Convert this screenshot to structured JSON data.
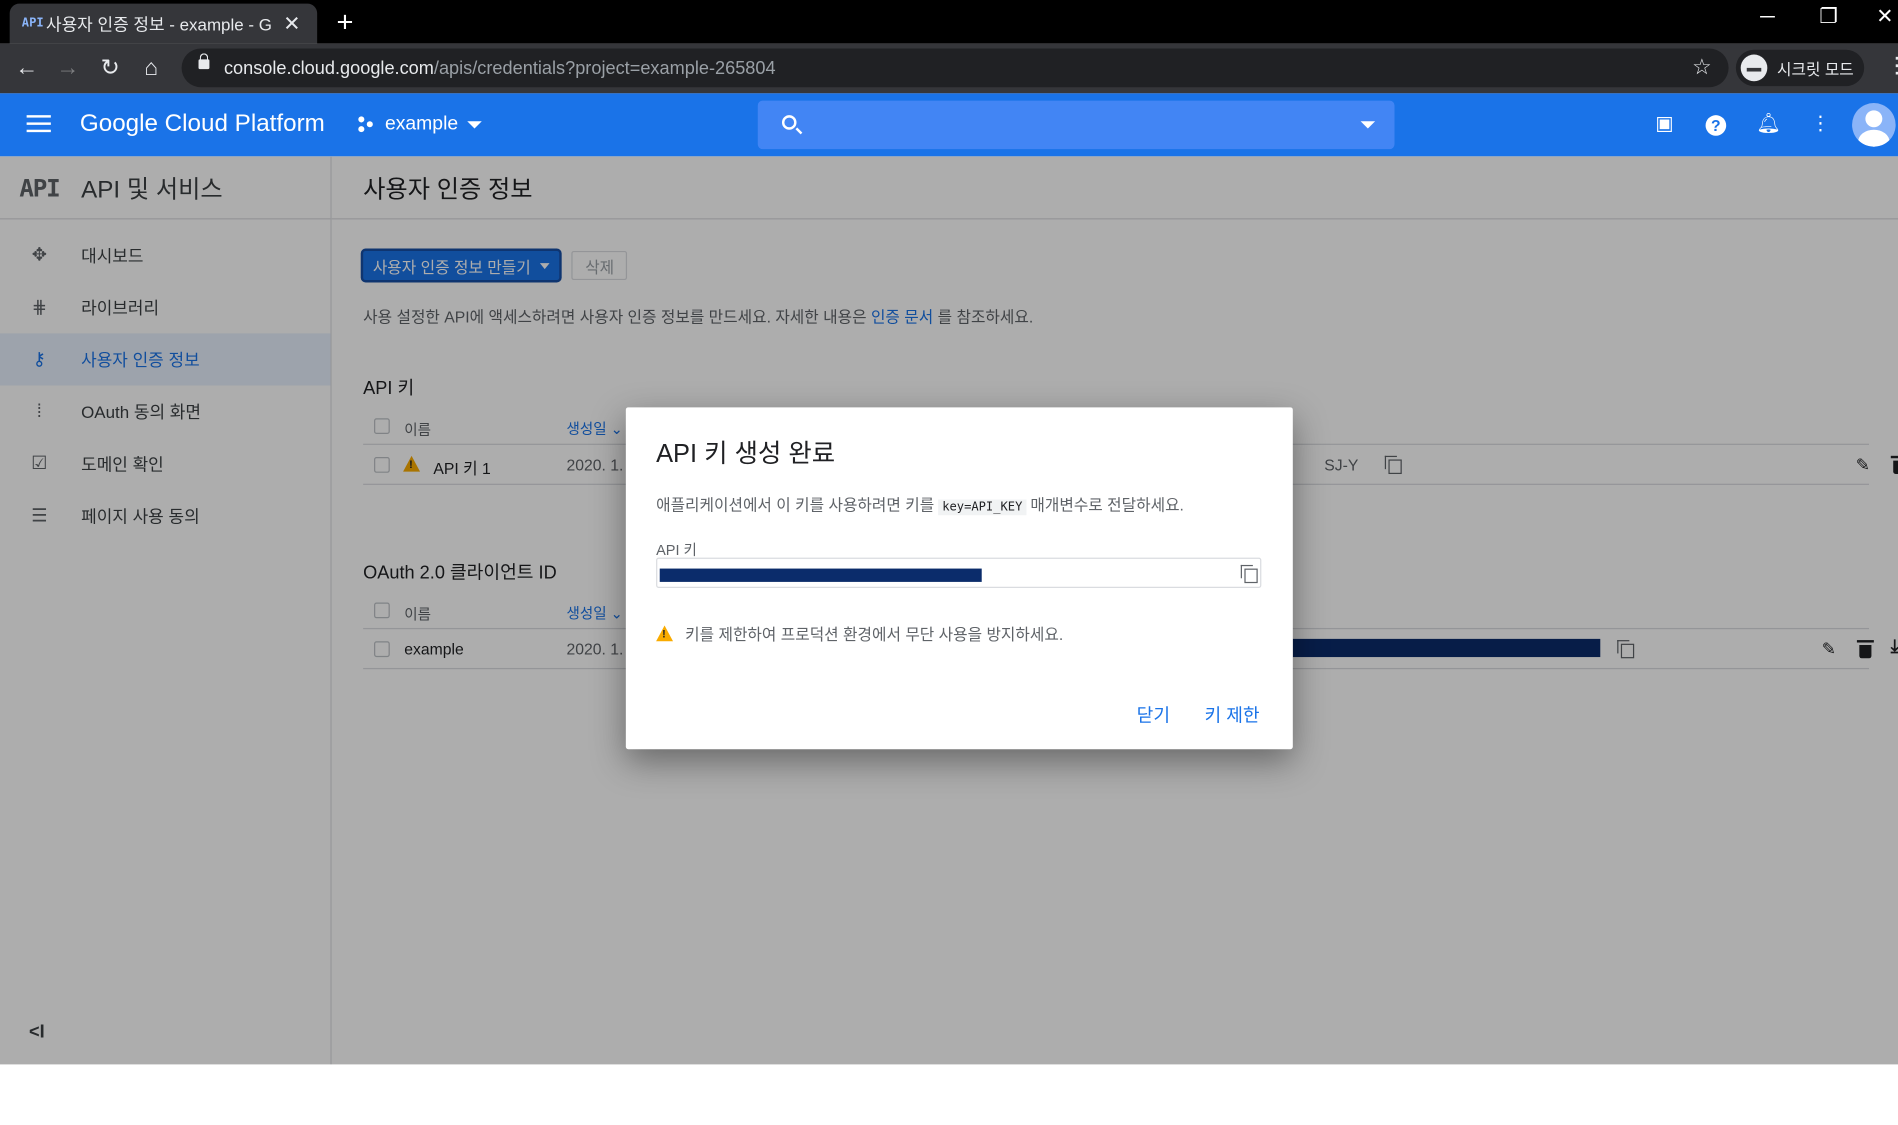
{
  "browser": {
    "tab_icon_text": "API",
    "tab_title": "사용자 인증 정보 - example - G",
    "url_host": "console.cloud.google.com",
    "url_path": "/apis/credentials?project=example-265804",
    "incognito_label": "시크릿 모드"
  },
  "header": {
    "logo_text": "Google Cloud Platform",
    "project_name": "example"
  },
  "sidebar": {
    "logo_text": "API",
    "title": "API 및 서비스",
    "items": [
      {
        "label": "대시보드",
        "icon": "dashboard-icon"
      },
      {
        "label": "라이브러리",
        "icon": "library-icon"
      },
      {
        "label": "사용자 인증 정보",
        "icon": "key-icon"
      },
      {
        "label": "OAuth 동의 화면",
        "icon": "oauth-icon"
      },
      {
        "label": "도메인 확인",
        "icon": "domain-verify-icon"
      },
      {
        "label": "페이지 사용 동의",
        "icon": "page-consent-icon"
      }
    ],
    "collapse_glyph": "<I"
  },
  "main": {
    "title": "사용자 인증 정보",
    "create_button": "사용자 인증 정보 만들기",
    "delete_button": "삭제",
    "intro_before": "사용 설정한 API에 액세스하려면 사용자 인증 정보를 만드세요. 자세한 내용은",
    "intro_link": "인증 문서",
    "intro_after": "를 참조하세요.",
    "api_keys": {
      "title": "API 키",
      "col_name": "이름",
      "col_created": "생성일",
      "rows": [
        {
          "name": "API 키 1",
          "created": "2020. 1.",
          "key_tail": "SJ-Y"
        }
      ]
    },
    "oauth": {
      "title": "OAuth 2.0 클라이언트 ID",
      "col_name": "이름",
      "col_created": "생성일",
      "rows": [
        {
          "name": "example",
          "created": "2020. 1."
        }
      ]
    }
  },
  "dialog": {
    "title": "API 키 생성 완료",
    "desc_before": "애플리케이션에서 이 키를 사용하려면 키를",
    "desc_code": "key=API_KEY",
    "desc_after": "매개변수로 전달하세요.",
    "field_label": "API 키",
    "warning": "키를 제한하여 프로덕션 환경에서 무단 사용을 방지하세요.",
    "close_button": "닫기",
    "restrict_button": "키 제한"
  }
}
